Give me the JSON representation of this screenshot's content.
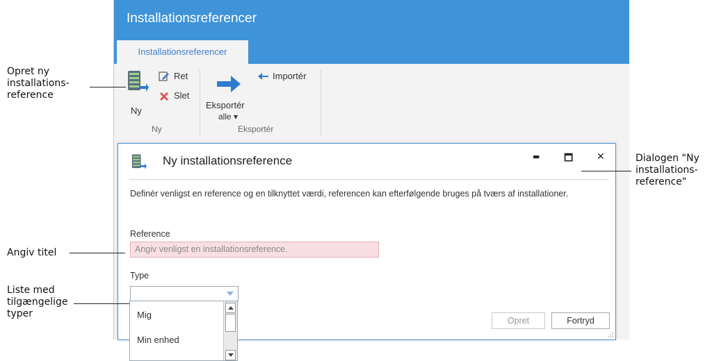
{
  "window": {
    "title": "Installationsreferencer"
  },
  "ribbon": {
    "tab_label": "Installationsreferencer",
    "buttons": {
      "ny": "Ny",
      "ret": "Ret",
      "slet": "Slet",
      "eksporter_line1": "Eksportér",
      "eksporter_line2": "alle ▾",
      "importer": "Importér"
    },
    "groups": {
      "ny": "Ny",
      "eksporter": "Eksportér"
    }
  },
  "dialog": {
    "title": "Ny installationsreference",
    "description": "Definér venligst en reference og en tilknyttet værdi, referencen kan efterfølgende bruges på tværs af installationer.",
    "reference_label": "Reference",
    "reference_placeholder": "Angiv venligst en installationsreference.",
    "type_label": "Type",
    "opret_label": "Opret",
    "fortryd_label": "Fortryd",
    "window_controls": {
      "minimize": "▬",
      "maximize": "🗖",
      "close": "✕"
    }
  },
  "dropdown": {
    "items": [
      "Mig",
      "Min enhed"
    ]
  },
  "callouts": {
    "opret_ny": "Opret ny\ninstallations-\nreference",
    "dialogen": "Dialogen \"Ny\ninstallations-\nreference\"",
    "angiv_titel": "Angiv titel",
    "liste": "Liste med\ntilgængelige\ntyper"
  },
  "colors": {
    "titlebar": "#3f93d8",
    "invalid_input_bg": "#f8dfe3",
    "ribbon_bg": "#f3f3f3",
    "delete_icon": "#e05353",
    "arrow_icon": "#2f7bcf"
  },
  "icons": [
    "server-icon",
    "edit-icon",
    "delete-icon",
    "export-arrow-icon",
    "import-arrow-icon"
  ]
}
